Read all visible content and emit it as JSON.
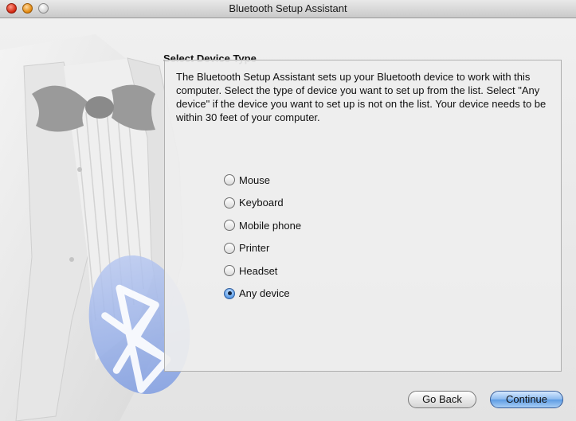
{
  "window": {
    "title": "Bluetooth Setup Assistant"
  },
  "header": {
    "section_title": "Select Device Type"
  },
  "main": {
    "description": "The Bluetooth Setup Assistant sets up your Bluetooth device to work with this computer. Select the type of device you want to set up from the list. Select \"Any device\" if the device you want to set up is not on the list. Your device needs to be within 30 feet of your computer.",
    "device_types": [
      {
        "label": "Mouse",
        "selected": false
      },
      {
        "label": "Keyboard",
        "selected": false
      },
      {
        "label": "Mobile phone",
        "selected": false
      },
      {
        "label": "Printer",
        "selected": false
      },
      {
        "label": "Headset",
        "selected": false
      },
      {
        "label": "Any device",
        "selected": true
      }
    ]
  },
  "footer": {
    "back_label": "Go Back",
    "continue_label": "Continue"
  },
  "colors": {
    "accent": "#5c9be3",
    "close_button": "#d42a14",
    "minimize_button": "#e38a10"
  }
}
